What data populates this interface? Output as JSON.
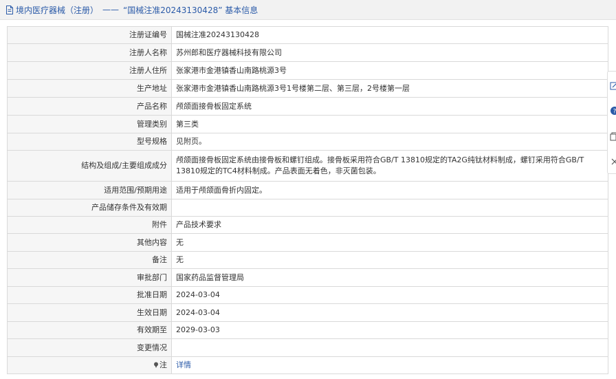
{
  "header": {
    "category": "境内医疗器械（注册）",
    "separator": "——",
    "title": "“国械注准20243130428” 基本信息"
  },
  "rows": [
    {
      "label": "注册证编号",
      "value": "国械注准20243130428"
    },
    {
      "label": "注册人名称",
      "value": "苏州郎和医疗器械科技有限公司"
    },
    {
      "label": "注册人住所",
      "value": "张家港市金港镇香山南路桃源3号"
    },
    {
      "label": "生产地址",
      "value": "张家港市金港镇香山南路桃源3号1号楼第二层、第三层，2号楼第一层"
    },
    {
      "label": "产品名称",
      "value": "颅颌面接骨板固定系统"
    },
    {
      "label": "管理类别",
      "value": "第三类"
    },
    {
      "label": "型号规格",
      "value": "见附页。"
    },
    {
      "label": "结构及组成/主要组成成分",
      "value": "颅颌面接骨板固定系统由接骨板和螺钉组成。接骨板采用符合GB/T 13810规定的TA2G纯钛材料制成，螺钉采用符合GB/T 13810规定的TC4材料制成。产品表面无着色，非灭菌包装。"
    },
    {
      "label": "适用范围/预期用途",
      "value": "适用于颅颌面骨折内固定。"
    },
    {
      "label": "产品储存条件及有效期",
      "value": ""
    },
    {
      "label": "附件",
      "value": "产品技术要求"
    },
    {
      "label": "其他内容",
      "value": "无"
    },
    {
      "label": "备注",
      "value": "无"
    },
    {
      "label": "审批部门",
      "value": "国家药品监督管理局"
    },
    {
      "label": "批准日期",
      "value": "2024-03-04"
    },
    {
      "label": "生效日期",
      "value": "2024-03-04"
    },
    {
      "label": "有效期至",
      "value": "2029-03-03"
    },
    {
      "label": "变更情况",
      "value": ""
    },
    {
      "label": "注",
      "value": "详情"
    }
  ],
  "icons": {
    "header": "document-icon",
    "note": "pin-icon",
    "side_tools": [
      "edit-icon",
      "help-icon",
      "copy-icon",
      "close-icon"
    ]
  },
  "colors": {
    "link": "#2a5aa8",
    "help_badge": "#2a5aa8"
  }
}
